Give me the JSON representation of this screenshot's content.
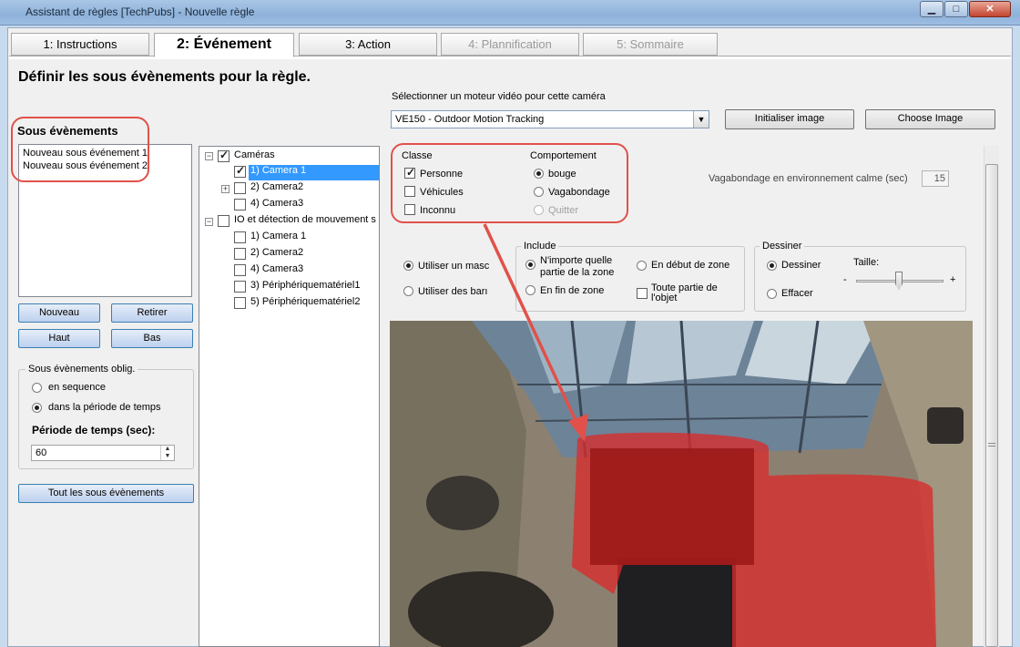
{
  "window": {
    "title": "Assistant de règles [TechPubs] - Nouvelle règle"
  },
  "tabs": [
    {
      "label": "1: Instructions",
      "state": "normal"
    },
    {
      "label": "2: Événement",
      "state": "active"
    },
    {
      "label": "3: Action",
      "state": "normal"
    },
    {
      "label": "4: Plannification",
      "state": "disabled"
    },
    {
      "label": "5: Sommaire",
      "state": "disabled"
    }
  ],
  "page_title": "Définir les sous évènements pour la règle.",
  "sub_events": {
    "title": "Sous évènements",
    "items": [
      "Nouveau sous événement 1",
      "Nouveau sous événement 2"
    ],
    "buttons": {
      "new": "Nouveau",
      "remove": "Retirer",
      "up": "Haut",
      "down": "Bas"
    },
    "mandatory_group": {
      "label": "Sous évènements oblig.",
      "options": [
        {
          "label": "en sequence",
          "selected": false
        },
        {
          "label": "dans la période de temps",
          "selected": true
        }
      ]
    },
    "period_label": "Période de temps (sec):",
    "period_value": "60",
    "all_button": "Tout les sous évènements"
  },
  "tree": {
    "cameras_root": {
      "label": "Caméras",
      "checked": true
    },
    "cameras": [
      {
        "label": "1) Camera 1",
        "checked": true,
        "selected": true,
        "expander": false
      },
      {
        "label": "2) Camera2",
        "checked": false,
        "selected": false,
        "expander": true
      },
      {
        "label": "4) Camera3",
        "checked": false,
        "selected": false,
        "expander": false
      }
    ],
    "io_root": {
      "label": "IO et détection de mouvement s",
      "checked": false
    },
    "io_items": [
      {
        "label": "1) Camera 1",
        "checked": false
      },
      {
        "label": "2) Camera2",
        "checked": false
      },
      {
        "label": "4) Camera3",
        "checked": false
      },
      {
        "label": "3) Périphériquematériel1",
        "checked": false
      },
      {
        "label": "5) Périphériquematériel2",
        "checked": false
      }
    ]
  },
  "engine": {
    "label": "Sélectionner un moteur vidéo pour cette caméra",
    "value": "VE150 - Outdoor Motion Tracking",
    "init_button": "Initialiser image",
    "choose_button": "Choose Image"
  },
  "classe": {
    "title": "Classe",
    "items": [
      {
        "label": "Personne",
        "checked": true
      },
      {
        "label": "Véhicules",
        "checked": false
      },
      {
        "label": "Inconnu",
        "checked": false
      }
    ]
  },
  "comportement": {
    "title": "Comportement",
    "items": [
      {
        "label": "bouge",
        "selected": true,
        "disabled": false
      },
      {
        "label": "Vagabondage",
        "selected": false,
        "disabled": false
      },
      {
        "label": "Quitter",
        "selected": false,
        "disabled": true
      }
    ]
  },
  "calm": {
    "label": "Vagabondage en environnement calme (sec)",
    "value": "15"
  },
  "mask": {
    "options": [
      {
        "label": "Utiliser un masc",
        "selected": true
      },
      {
        "label": "Utiliser des barı",
        "selected": false
      }
    ]
  },
  "include": {
    "label": "Include",
    "options": [
      {
        "label_line1": "N'importe quelle",
        "label_line2": "partie de la zone",
        "selected": true
      },
      {
        "label_line1": "En début de zone",
        "label_line2": "",
        "selected": false
      },
      {
        "label_line1": "En fin de zone",
        "label_line2": "",
        "selected": false
      }
    ],
    "checkbox": {
      "label_line1": "Toute partie de",
      "label_line2": "l'objet",
      "checked": false
    }
  },
  "draw": {
    "label": "Dessiner",
    "options": [
      {
        "label": "Dessiner",
        "selected": true
      },
      {
        "label": "Effacer",
        "selected": false
      }
    ],
    "size_label": "Taille:",
    "minus": "-",
    "plus": "+"
  },
  "colors": {
    "highlight": "#e0514a",
    "selection": "#3399ff",
    "mask_red": "#d92b2b"
  }
}
